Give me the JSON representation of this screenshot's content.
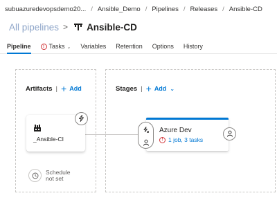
{
  "breadcrumb": {
    "items": [
      "subuazuredevopsdemo20...",
      "Ansible_Demo",
      "Pipelines",
      "Releases",
      "Ansible-CD"
    ],
    "separator": "/"
  },
  "header": {
    "all_pipelines": "All pipelines",
    "chevron": ">",
    "pipeline_name": "Ansible-CD"
  },
  "tabs": {
    "pipeline": "Pipeline",
    "tasks": "Tasks",
    "variables": "Variables",
    "retention": "Retention",
    "options": "Options",
    "history": "History"
  },
  "artifacts": {
    "title": "Artifacts",
    "separator": "|",
    "add_label": "Add",
    "artifact_name": "_Ansible-CI",
    "schedule_line1": "Schedule",
    "schedule_line2": "not set"
  },
  "stages": {
    "title": "Stages",
    "separator": "|",
    "add_label": "Add",
    "stage_name": "Azure Dev",
    "stage_status": "1 job, 3 tasks"
  },
  "colors": {
    "accent": "#0078d4",
    "error": "#d13438",
    "muted_link": "#8fa6c9"
  }
}
